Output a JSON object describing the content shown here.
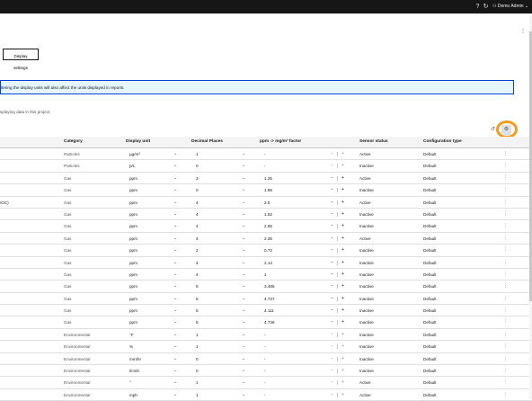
{
  "topbar": {
    "user_label": "Demo Admin",
    "help_icon": "help-icon",
    "refresh_icon": "refresh-icon",
    "user_icon": "user-icon",
    "chevron_icon": "chevron-down-icon"
  },
  "toolbar": {
    "display_settings_label": "Display settings"
  },
  "banner": {
    "text": "ltering the display units will also affect the units displayed in reports."
  },
  "info": {
    "text": "splaying data in this project."
  },
  "colors": {
    "topbar": "#161616",
    "banner_bg": "#e5f6ff",
    "banner_border": "#0043ce",
    "highlight_ring": "#f29b1c"
  },
  "table": {
    "headers": {
      "name": "",
      "category": "Category",
      "unit": "Display unit",
      "decimal": "Decimal Places",
      "factor": "ppm -> mg/m³ factor",
      "status": "Sensor status",
      "config": "Configuration type"
    },
    "rows": [
      {
        "name": "",
        "category": "Particles",
        "unit": "µg/m³",
        "decimal": "1",
        "factor": "-",
        "factor_active": false,
        "status": "Active",
        "config": "Default"
      },
      {
        "name": "",
        "category": "Particles",
        "unit": "p/L",
        "decimal": "0",
        "factor": "-",
        "factor_active": false,
        "status": "Inactive",
        "config": "Default"
      },
      {
        "name": "",
        "category": "Gas",
        "unit": "ppm",
        "decimal": "3",
        "factor": "1.25",
        "factor_active": true,
        "status": "Active",
        "config": "Default"
      },
      {
        "name": "",
        "category": "Gas",
        "unit": "ppm",
        "decimal": "0",
        "factor": "1.96",
        "factor_active": true,
        "status": "Inactive",
        "config": "Default"
      },
      {
        "name": "/OC)",
        "category": "Gas",
        "unit": "ppm",
        "decimal": "4",
        "factor": "2.5",
        "factor_active": true,
        "status": "Active",
        "config": "Default"
      },
      {
        "name": "",
        "category": "Gas",
        "unit": "ppm",
        "decimal": "4",
        "factor": "1.52",
        "factor_active": true,
        "status": "Inactive",
        "config": "Default"
      },
      {
        "name": "",
        "category": "Gas",
        "unit": "ppm",
        "decimal": "4",
        "factor": "2.86",
        "factor_active": true,
        "status": "Inactive",
        "config": "Default"
      },
      {
        "name": "",
        "category": "Gas",
        "unit": "ppm",
        "decimal": "4",
        "factor": "2.05",
        "factor_active": true,
        "status": "Active",
        "config": "Default"
      },
      {
        "name": "",
        "category": "Gas",
        "unit": "ppm",
        "decimal": "2",
        "factor": "0.72",
        "factor_active": true,
        "status": "Inactive",
        "config": "Default"
      },
      {
        "name": "",
        "category": "Gas",
        "unit": "ppm",
        "decimal": "4",
        "factor": "2.14",
        "factor_active": true,
        "status": "Inactive",
        "config": "Default"
      },
      {
        "name": "",
        "category": "Gas",
        "unit": "ppm",
        "decimal": "4",
        "factor": "1",
        "factor_active": true,
        "status": "Inactive",
        "config": "Default"
      },
      {
        "name": "",
        "category": "Gas",
        "unit": "ppm",
        "decimal": "5",
        "factor": "3.485",
        "factor_active": true,
        "status": "Inactive",
        "config": "Default"
      },
      {
        "name": "",
        "category": "Gas",
        "unit": "ppm",
        "decimal": "5",
        "factor": "4.737",
        "factor_active": true,
        "status": "Inactive",
        "config": "Default"
      },
      {
        "name": "",
        "category": "Gas",
        "unit": "ppm",
        "decimal": "5",
        "factor": "4.111",
        "factor_active": true,
        "status": "Inactive",
        "config": "Default"
      },
      {
        "name": "",
        "category": "Gas",
        "unit": "ppm",
        "decimal": "5",
        "factor": "4.736",
        "factor_active": true,
        "status": "Inactive",
        "config": "Default"
      },
      {
        "name": "",
        "category": "Environmental",
        "unit": "°F",
        "decimal": "1",
        "factor": "-",
        "factor_active": false,
        "status": "Inactive",
        "config": "Default"
      },
      {
        "name": "",
        "category": "Environmental",
        "unit": "%",
        "decimal": "1",
        "factor": "-",
        "factor_active": false,
        "status": "Inactive",
        "config": "Default"
      },
      {
        "name": "",
        "category": "Environmental",
        "unit": "mm/hr",
        "decimal": "0",
        "factor": "-",
        "factor_active": false,
        "status": "Inactive",
        "config": "Default"
      },
      {
        "name": "",
        "category": "Environmental",
        "unit": "l/cmh",
        "decimal": "0",
        "factor": "-",
        "factor_active": false,
        "status": "Inactive",
        "config": "Default"
      },
      {
        "name": "",
        "category": "Environmental",
        "unit": "°",
        "decimal": "1",
        "factor": "-",
        "factor_active": false,
        "status": "Active",
        "config": "Default"
      },
      {
        "name": "",
        "category": "Environmental",
        "unit": "mph",
        "decimal": "1",
        "factor": "-",
        "factor_active": false,
        "status": "Active",
        "config": "Default"
      }
    ]
  }
}
